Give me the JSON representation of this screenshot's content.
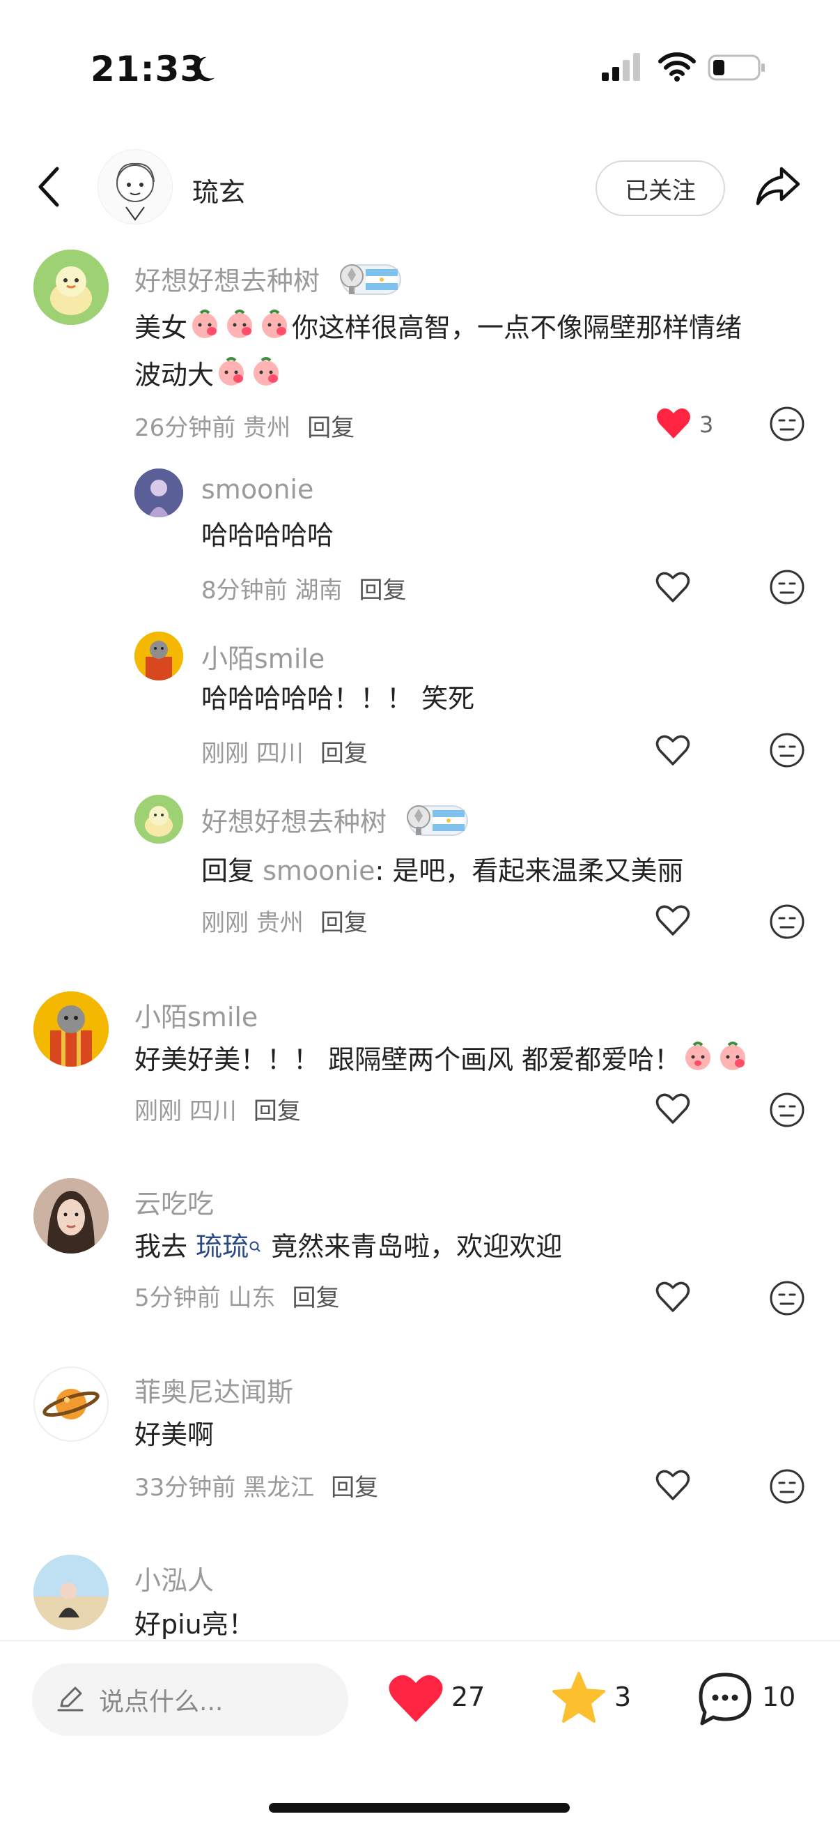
{
  "status_bar": {
    "time": "21:33"
  },
  "header": {
    "username": "琉玄",
    "follow_label": "已关注"
  },
  "comments": [
    {
      "user": "好想好想去种树",
      "text_before": "美女",
      "text_mid": "你这样很高智，一点不像隔壁那样情绪",
      "text_line2": "波动大",
      "time": "26分钟前",
      "location": "贵州",
      "reply_label": "回复",
      "likes": "3",
      "replies": [
        {
          "user": "smoonie",
          "text": "哈哈哈哈哈",
          "time": "8分钟前",
          "location": "湖南",
          "reply_label": "回复"
        },
        {
          "user": "小陌smile",
          "text": "哈哈哈哈哈！！！ 笑死",
          "time": "刚刚",
          "location": "四川",
          "reply_label": "回复"
        },
        {
          "user": "好想好想去种树",
          "reply_prefix": "回复",
          "reply_to": "smoonie",
          "text": ": 是吧，看起来温柔又美丽",
          "time": "刚刚",
          "location": "贵州",
          "reply_label": "回复"
        }
      ]
    },
    {
      "user": "小陌smile",
      "text": "好美好美！！！ 跟隔壁两个画风 都爱都爱哈！",
      "time": "刚刚",
      "location": "四川",
      "reply_label": "回复"
    },
    {
      "user": "云吃吃",
      "text_before": "我去",
      "mention": "琉琉",
      "text_after": "竟然来青岛啦，欢迎欢迎",
      "time": "5分钟前",
      "location": "山东",
      "reply_label": "回复"
    },
    {
      "user": "菲奥尼达闻斯",
      "text": "好美啊",
      "time": "33分钟前",
      "location": "黑龙江",
      "reply_label": "回复"
    },
    {
      "user": "小泓人",
      "text": "好piu亮！"
    }
  ],
  "bottom_bar": {
    "placeholder": "说点什么...",
    "likes": "27",
    "stars": "3",
    "comments": "10"
  },
  "colors": {
    "like_red": "#ff2442",
    "star_yellow": "#fcbf2d",
    "mention_blue": "#2a4a86"
  }
}
